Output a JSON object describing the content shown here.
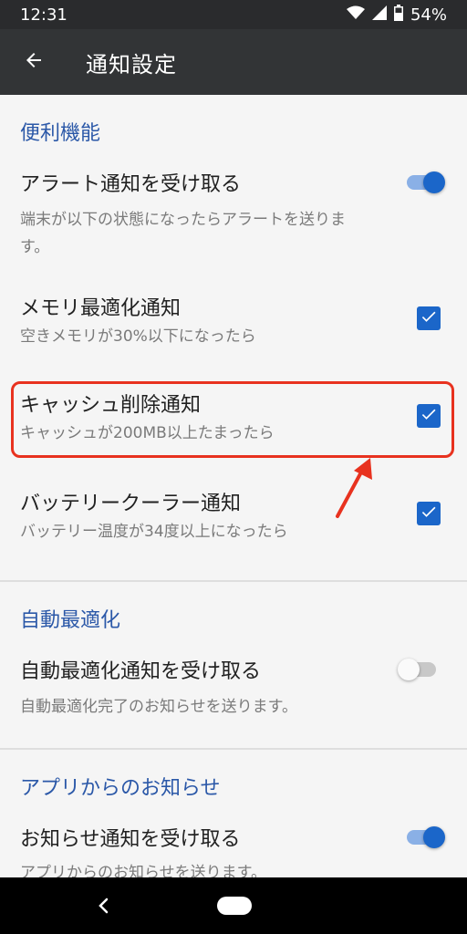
{
  "status_bar": {
    "time": "12:31",
    "battery_percent": "54%",
    "icons": [
      "wifi-icon",
      "signal-icon",
      "battery-icon"
    ]
  },
  "app_bar": {
    "title": "通知設定",
    "back_icon": "arrow-left-icon"
  },
  "sections": [
    {
      "header": "便利機能",
      "items": [
        {
          "title": "アラート通知を受け取る",
          "subtitle_line1": "端末が以下の状態になったらアラートを送りま",
          "subtitle_line2": "す。",
          "control": "toggle",
          "checked": true
        },
        {
          "title": "メモリ最適化通知",
          "subtitle": "空きメモリが30%以下になったら",
          "control": "checkbox",
          "checked": true
        },
        {
          "title": "キャッシュ削除通知",
          "subtitle": "キャッシュが200MB以上たまったら",
          "control": "checkbox",
          "checked": true
        },
        {
          "title": "バッテリークーラー通知",
          "subtitle": "バッテリー温度が34度以上になったら",
          "control": "checkbox",
          "checked": true
        }
      ]
    },
    {
      "header": "自動最適化",
      "items": [
        {
          "title": "自動最適化通知を受け取る",
          "subtitle": "自動最適化完了のお知らせを送ります。",
          "control": "toggle",
          "checked": false
        }
      ]
    },
    {
      "header": "アプリからのお知らせ",
      "items": [
        {
          "title": "お知らせ通知を受け取る",
          "subtitle": "アプリからのお知らせを送ります。",
          "control": "toggle",
          "checked": true
        }
      ]
    }
  ],
  "colors": {
    "accent": "#1b66c9",
    "section_header": "#2b58a8",
    "highlight": "#e8321f",
    "app_bar": "#323436"
  },
  "nav_bar": {
    "icons": [
      "nav-back-icon",
      "nav-home-pill"
    ]
  }
}
